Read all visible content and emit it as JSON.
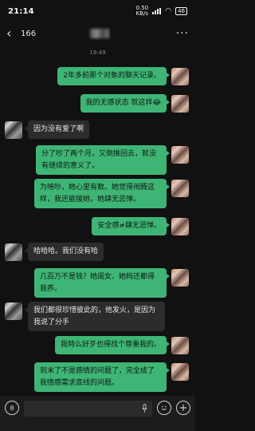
{
  "status_bar": {
    "time": "21:14",
    "net_speed": "0.50\nKB/s",
    "battery": "46"
  },
  "header": {
    "unread_count": "166"
  },
  "chat": {
    "timestamp": "19:49",
    "messages": [
      {
        "from": "me",
        "text": "2年多前那个对象的聊天记录。"
      },
      {
        "from": "me",
        "text": "我的无感状态 就这样😂"
      },
      {
        "from": "them",
        "text": "因为没有爱了啊"
      },
      {
        "from": "me",
        "text": "分了吵了两个月，又倒推回去，就没有继续的意义了。"
      },
      {
        "from": "me",
        "text": "为啥吵，她心里有数。她觉得闹腾这样，我还能接她，她肆无忌惮。"
      },
      {
        "from": "me",
        "text": "安全感≠肆无忌惮。"
      },
      {
        "from": "them",
        "text": "哈哈哈。我们没有哈"
      },
      {
        "from": "me",
        "text": "几百万不是钱？她闺女、她妈还都得我养。"
      },
      {
        "from": "them",
        "text": "我们都很珍惜彼此的，他发火，是因为我说了分手"
      },
      {
        "from": "me",
        "text": "我特么好歹也得找个尊重我的。"
      },
      {
        "from": "me",
        "text": "到末了不是感情的问题了，完全成了我情感需求底线的问题。"
      }
    ]
  },
  "input_bar": {
    "voice_icon": "voice-icon",
    "emoji_icon": "emoji-icon",
    "plus_icon": "plus-icon"
  }
}
